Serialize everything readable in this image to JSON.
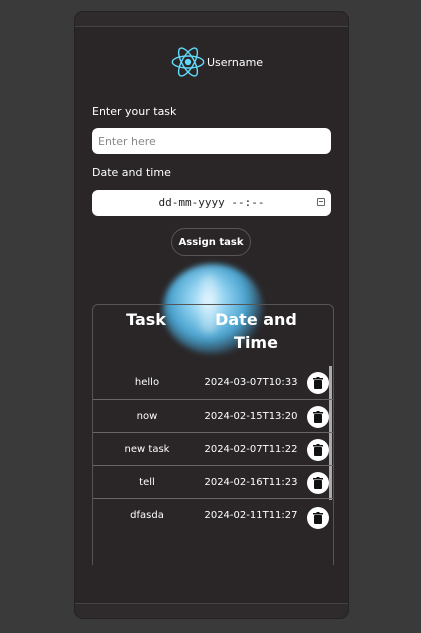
{
  "app": {
    "username": "Username"
  },
  "form": {
    "task_label": "Enter your task",
    "task_placeholder": "Enter here",
    "datetime_label": "Date and time",
    "datetime_placeholder": "dd-mm-yyyy --:--",
    "assign_button": "Assign task"
  },
  "table": {
    "headers": [
      "Task",
      "Date and Time"
    ],
    "rows": [
      {
        "task": "hello",
        "date": "2024-03-07T10:33"
      },
      {
        "task": "now",
        "date": "2024-02-15T13:20"
      },
      {
        "task": "new task",
        "date": "2024-02-07T11:22"
      },
      {
        "task": "tell",
        "date": "2024-02-16T11:23"
      },
      {
        "task": "dfasda",
        "date": "2024-02-11T11:27"
      }
    ]
  },
  "icons": {
    "logo": "react-logo-icon",
    "calendar": "calendar-icon",
    "delete": "trash-icon"
  },
  "colors": {
    "background": "#3a3a3a",
    "card": "#2a2627",
    "accent": "#61dafb"
  }
}
